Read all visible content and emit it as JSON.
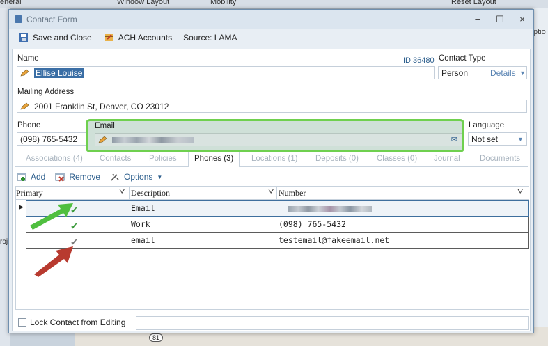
{
  "background": {
    "menu_left": "eneral",
    "menu_window_layout": "Window Layout",
    "menu_mobility": "Mobility",
    "menu_reset_layout": "Reset Layout",
    "side_text": "ptio",
    "left_text": "roj",
    "map_label": "81"
  },
  "window": {
    "title": "Contact Form",
    "minimize": "–",
    "maximize": "☐",
    "close": "×"
  },
  "toolbar": {
    "save_label": "Save and Close",
    "ach_label": "ACH Accounts",
    "source_label": "Source: LAMA"
  },
  "form": {
    "name_label": "Name",
    "name_value": "Ellise Louise",
    "id_text": "ID 36480",
    "contact_type_label": "Contact Type",
    "contact_type_value": "Person",
    "details_link": "Details",
    "mailing_label": "Mailing Address",
    "mailing_value": "2001 Franklin St, Denver, CO 23012",
    "phone_label": "Phone",
    "phone_value": "(098) 765-5432",
    "email_label": "Email",
    "language_label": "Language",
    "language_value": "Not set"
  },
  "tabs": [
    {
      "label": "Associations (4)"
    },
    {
      "label": "Contacts"
    },
    {
      "label": "Policies"
    },
    {
      "label": "Phones (3)"
    },
    {
      "label": "Locations (1)"
    },
    {
      "label": "Deposits (0)"
    },
    {
      "label": "Classes (0)"
    },
    {
      "label": "Journal"
    },
    {
      "label": "Documents"
    }
  ],
  "grid_toolbar": {
    "add": "Add",
    "remove": "Remove",
    "options": "Options"
  },
  "grid": {
    "columns": [
      "Primary",
      "Description",
      "Number"
    ],
    "rows": [
      {
        "primary": "✔",
        "description": "Email",
        "number": ""
      },
      {
        "primary": "✔",
        "description": "Work",
        "number": "(098) 765-5432"
      },
      {
        "primary": "✔",
        "description": "email",
        "number": "testemail@fakeemail.net"
      }
    ]
  },
  "footer": {
    "lock_label": "Lock Contact from Editing"
  },
  "colors": {
    "highlight_green": "#6fd04f",
    "arrow_green": "#4fbf3f",
    "arrow_red": "#b83a2f",
    "link_blue": "#2b5d8c"
  }
}
